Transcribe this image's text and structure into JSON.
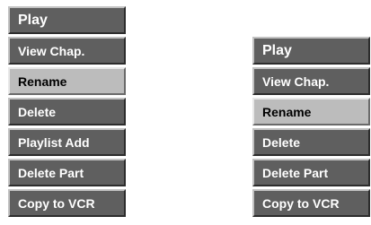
{
  "menus": [
    {
      "items": [
        {
          "label": "Play",
          "selected": false
        },
        {
          "label": "View Chap.",
          "selected": false
        },
        {
          "label": "Rename",
          "selected": true
        },
        {
          "label": "Delete",
          "selected": false
        },
        {
          "label": "Playlist Add",
          "selected": false
        },
        {
          "label": "Delete Part",
          "selected": false
        },
        {
          "label": "Copy to VCR",
          "selected": false
        }
      ]
    },
    {
      "items": [
        {
          "label": "Play",
          "selected": false
        },
        {
          "label": "View Chap.",
          "selected": false
        },
        {
          "label": "Rename",
          "selected": true
        },
        {
          "label": "Delete",
          "selected": false
        },
        {
          "label": "Delete Part",
          "selected": false
        },
        {
          "label": "Copy to VCR",
          "selected": false
        }
      ]
    }
  ]
}
